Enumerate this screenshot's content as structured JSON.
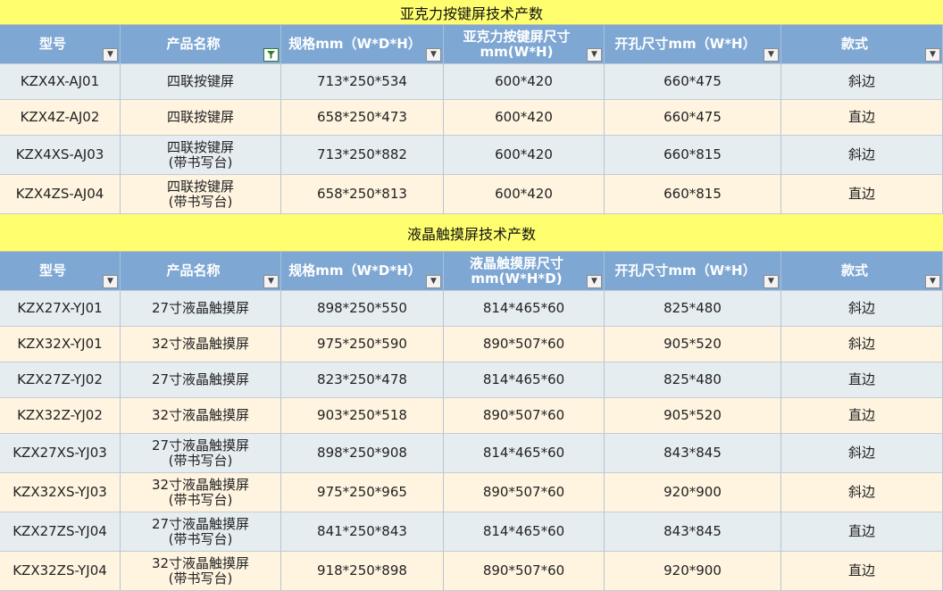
{
  "headers": [
    "型号",
    "产品名称",
    "规格mm（W*D*H）",
    "开孔尺寸mm（W*H）",
    "款式"
  ],
  "sections": [
    {
      "title": "亚克力按键屏技术产数",
      "size_header": "亚克力按键屏尺寸\nmm(W*H)",
      "rows": [
        {
          "model": "KZX4X-AJ01",
          "name": "四联按键屏",
          "spec": "713*250*534",
          "size": "600*420",
          "hole": "660*475",
          "style": "斜边"
        },
        {
          "model": "KZX4Z-AJ02",
          "name": "四联按键屏",
          "spec": "658*250*473",
          "size": "600*420",
          "hole": "660*475",
          "style": "直边"
        },
        {
          "model": "KZX4XS-AJ03",
          "name": "四联按键屏\n(带书写台)",
          "spec": "713*250*882",
          "size": "600*420",
          "hole": "660*815",
          "style": "斜边"
        },
        {
          "model": "KZX4ZS-AJ04",
          "name": "四联按键屏\n(带书写台)",
          "spec": "658*250*813",
          "size": "600*420",
          "hole": "660*815",
          "style": "直边"
        }
      ]
    },
    {
      "title": "液晶触摸屏技术产数",
      "size_header": "液晶触摸屏尺寸\nmm(W*H*D)",
      "rows": [
        {
          "model": "KZX27X-YJ01",
          "name": "27寸液晶触摸屏",
          "spec": "898*250*550",
          "size": "814*465*60",
          "hole": "825*480",
          "style": "斜边"
        },
        {
          "model": "KZX32X-YJ01",
          "name": "32寸液晶触摸屏",
          "spec": "975*250*590",
          "size": "890*507*60",
          "hole": "905*520",
          "style": "斜边"
        },
        {
          "model": "KZX27Z-YJ02",
          "name": "27寸液晶触摸屏",
          "spec": "823*250*478",
          "size": "814*465*60",
          "hole": "825*480",
          "style": "直边"
        },
        {
          "model": "KZX32Z-YJ02",
          "name": "32寸液晶触摸屏",
          "spec": "903*250*518",
          "size": "890*507*60",
          "hole": "905*520",
          "style": "直边"
        },
        {
          "model": "KZX27XS-YJ03",
          "name": "27寸液晶触摸屏\n(带书写台)",
          "spec": "898*250*908",
          "size": "814*465*60",
          "hole": "843*845",
          "style": "斜边"
        },
        {
          "model": "KZX32XS-YJ03",
          "name": "32寸液晶触摸屏\n(带书写台)",
          "spec": "975*250*965",
          "size": "890*507*60",
          "hole": "920*900",
          "style": "斜边"
        },
        {
          "model": "KZX27ZS-YJ04",
          "name": "27寸液晶触摸屏\n(带书写台)",
          "spec": "841*250*843",
          "size": "814*465*60",
          "hole": "843*845",
          "style": "直边"
        },
        {
          "model": "KZX32ZS-YJ04",
          "name": "32寸液晶触摸屏\n(带书写台)",
          "spec": "918*250*898",
          "size": "890*507*60",
          "hole": "920*900",
          "style": "直边"
        }
      ]
    }
  ]
}
